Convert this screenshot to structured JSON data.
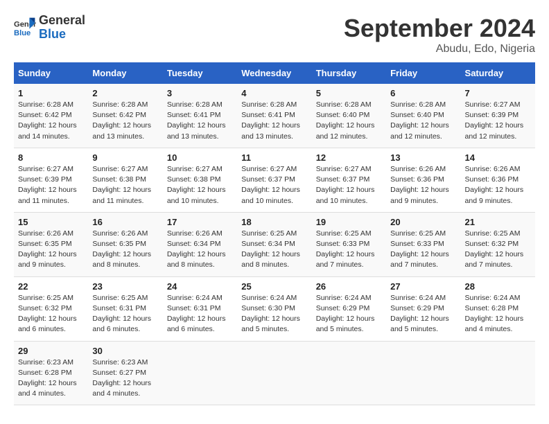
{
  "logo": {
    "line1": "General",
    "line2": "Blue"
  },
  "title": "September 2024",
  "location": "Abudu, Edo, Nigeria",
  "days_of_week": [
    "Sunday",
    "Monday",
    "Tuesday",
    "Wednesday",
    "Thursday",
    "Friday",
    "Saturday"
  ],
  "weeks": [
    [
      {
        "day": "1",
        "sunrise": "Sunrise: 6:28 AM",
        "sunset": "Sunset: 6:42 PM",
        "daylight": "Daylight: 12 hours and 14 minutes."
      },
      {
        "day": "2",
        "sunrise": "Sunrise: 6:28 AM",
        "sunset": "Sunset: 6:42 PM",
        "daylight": "Daylight: 12 hours and 13 minutes."
      },
      {
        "day": "3",
        "sunrise": "Sunrise: 6:28 AM",
        "sunset": "Sunset: 6:41 PM",
        "daylight": "Daylight: 12 hours and 13 minutes."
      },
      {
        "day": "4",
        "sunrise": "Sunrise: 6:28 AM",
        "sunset": "Sunset: 6:41 PM",
        "daylight": "Daylight: 12 hours and 13 minutes."
      },
      {
        "day": "5",
        "sunrise": "Sunrise: 6:28 AM",
        "sunset": "Sunset: 6:40 PM",
        "daylight": "Daylight: 12 hours and 12 minutes."
      },
      {
        "day": "6",
        "sunrise": "Sunrise: 6:28 AM",
        "sunset": "Sunset: 6:40 PM",
        "daylight": "Daylight: 12 hours and 12 minutes."
      },
      {
        "day": "7",
        "sunrise": "Sunrise: 6:27 AM",
        "sunset": "Sunset: 6:39 PM",
        "daylight": "Daylight: 12 hours and 12 minutes."
      }
    ],
    [
      {
        "day": "8",
        "sunrise": "Sunrise: 6:27 AM",
        "sunset": "Sunset: 6:39 PM",
        "daylight": "Daylight: 12 hours and 11 minutes."
      },
      {
        "day": "9",
        "sunrise": "Sunrise: 6:27 AM",
        "sunset": "Sunset: 6:38 PM",
        "daylight": "Daylight: 12 hours and 11 minutes."
      },
      {
        "day": "10",
        "sunrise": "Sunrise: 6:27 AM",
        "sunset": "Sunset: 6:38 PM",
        "daylight": "Daylight: 12 hours and 10 minutes."
      },
      {
        "day": "11",
        "sunrise": "Sunrise: 6:27 AM",
        "sunset": "Sunset: 6:37 PM",
        "daylight": "Daylight: 12 hours and 10 minutes."
      },
      {
        "day": "12",
        "sunrise": "Sunrise: 6:27 AM",
        "sunset": "Sunset: 6:37 PM",
        "daylight": "Daylight: 12 hours and 10 minutes."
      },
      {
        "day": "13",
        "sunrise": "Sunrise: 6:26 AM",
        "sunset": "Sunset: 6:36 PM",
        "daylight": "Daylight: 12 hours and 9 minutes."
      },
      {
        "day": "14",
        "sunrise": "Sunrise: 6:26 AM",
        "sunset": "Sunset: 6:36 PM",
        "daylight": "Daylight: 12 hours and 9 minutes."
      }
    ],
    [
      {
        "day": "15",
        "sunrise": "Sunrise: 6:26 AM",
        "sunset": "Sunset: 6:35 PM",
        "daylight": "Daylight: 12 hours and 9 minutes."
      },
      {
        "day": "16",
        "sunrise": "Sunrise: 6:26 AM",
        "sunset": "Sunset: 6:35 PM",
        "daylight": "Daylight: 12 hours and 8 minutes."
      },
      {
        "day": "17",
        "sunrise": "Sunrise: 6:26 AM",
        "sunset": "Sunset: 6:34 PM",
        "daylight": "Daylight: 12 hours and 8 minutes."
      },
      {
        "day": "18",
        "sunrise": "Sunrise: 6:25 AM",
        "sunset": "Sunset: 6:34 PM",
        "daylight": "Daylight: 12 hours and 8 minutes."
      },
      {
        "day": "19",
        "sunrise": "Sunrise: 6:25 AM",
        "sunset": "Sunset: 6:33 PM",
        "daylight": "Daylight: 12 hours and 7 minutes."
      },
      {
        "day": "20",
        "sunrise": "Sunrise: 6:25 AM",
        "sunset": "Sunset: 6:33 PM",
        "daylight": "Daylight: 12 hours and 7 minutes."
      },
      {
        "day": "21",
        "sunrise": "Sunrise: 6:25 AM",
        "sunset": "Sunset: 6:32 PM",
        "daylight": "Daylight: 12 hours and 7 minutes."
      }
    ],
    [
      {
        "day": "22",
        "sunrise": "Sunrise: 6:25 AM",
        "sunset": "Sunset: 6:32 PM",
        "daylight": "Daylight: 12 hours and 6 minutes."
      },
      {
        "day": "23",
        "sunrise": "Sunrise: 6:25 AM",
        "sunset": "Sunset: 6:31 PM",
        "daylight": "Daylight: 12 hours and 6 minutes."
      },
      {
        "day": "24",
        "sunrise": "Sunrise: 6:24 AM",
        "sunset": "Sunset: 6:31 PM",
        "daylight": "Daylight: 12 hours and 6 minutes."
      },
      {
        "day": "25",
        "sunrise": "Sunrise: 6:24 AM",
        "sunset": "Sunset: 6:30 PM",
        "daylight": "Daylight: 12 hours and 5 minutes."
      },
      {
        "day": "26",
        "sunrise": "Sunrise: 6:24 AM",
        "sunset": "Sunset: 6:29 PM",
        "daylight": "Daylight: 12 hours and 5 minutes."
      },
      {
        "day": "27",
        "sunrise": "Sunrise: 6:24 AM",
        "sunset": "Sunset: 6:29 PM",
        "daylight": "Daylight: 12 hours and 5 minutes."
      },
      {
        "day": "28",
        "sunrise": "Sunrise: 6:24 AM",
        "sunset": "Sunset: 6:28 PM",
        "daylight": "Daylight: 12 hours and 4 minutes."
      }
    ],
    [
      {
        "day": "29",
        "sunrise": "Sunrise: 6:23 AM",
        "sunset": "Sunset: 6:28 PM",
        "daylight": "Daylight: 12 hours and 4 minutes."
      },
      {
        "day": "30",
        "sunrise": "Sunrise: 6:23 AM",
        "sunset": "Sunset: 6:27 PM",
        "daylight": "Daylight: 12 hours and 4 minutes."
      },
      null,
      null,
      null,
      null,
      null
    ]
  ]
}
